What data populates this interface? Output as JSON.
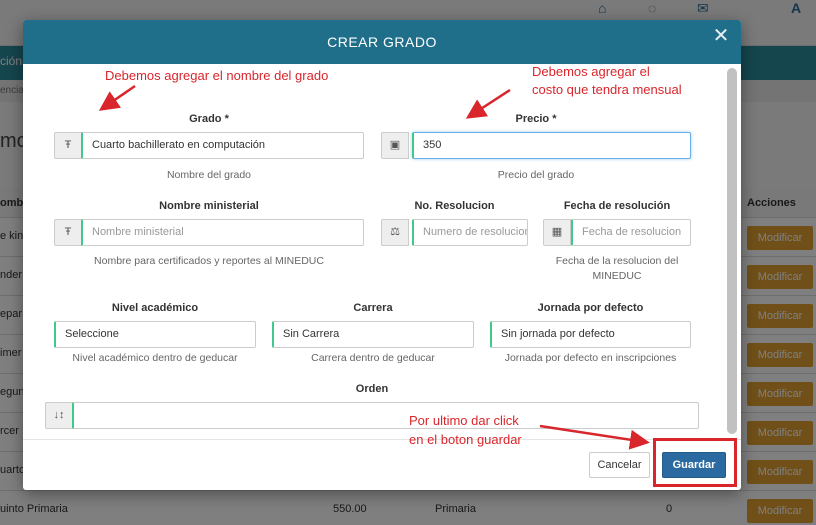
{
  "background": {
    "teal_bar_text": "ción",
    "breadcrumb_text": "encia",
    "page_title_fragment": "mo",
    "table_header_col1": "ombr",
    "table_header_actions": "Acciones",
    "row_fragments": [
      "e kin",
      "nder",
      "epar",
      "imer",
      "egun",
      "rcer",
      "uarto",
      "uinto Primaria"
    ],
    "last_row_price": "550.00",
    "last_row_level": "Primaria",
    "last_row_order": "0",
    "action_button_label": "Modificar"
  },
  "modal": {
    "title": "CREAR GRADO",
    "close_icon": "close-icon",
    "fields": {
      "grado": {
        "label": "Grado *",
        "value": "Cuarto bachillerato en computación",
        "help": "Nombre del grado",
        "icon": "text-icon"
      },
      "precio": {
        "label": "Precio *",
        "value": "350",
        "help": "Precio del grado",
        "icon": "money-icon"
      },
      "nombre_ministerial": {
        "label": "Nombre ministerial",
        "placeholder": "Nombre ministerial",
        "help": "Nombre para certificados y reportes al MINEDUC",
        "icon": "text-icon"
      },
      "no_resolucion": {
        "label": "No. Resolucion",
        "placeholder": "Numero de resolucion",
        "icon": "scale-icon"
      },
      "fecha_resolucion": {
        "label": "Fecha de resolución",
        "placeholder": "Fecha de resolucion",
        "help_line1": "Fecha de la resolucion del",
        "help_line2": "MINEDUC",
        "icon": "calendar-icon"
      },
      "nivel_academico": {
        "label": "Nivel académico",
        "value": "Seleccione",
        "help": "Nivel académico dentro de geducar"
      },
      "carrera": {
        "label": "Carrera",
        "value": "Sin Carrera",
        "help": "Carrera dentro de geducar"
      },
      "jornada": {
        "label": "Jornada por defecto",
        "value": "Sin jornada por defecto",
        "help": "Jornada por defecto en inscripciones"
      },
      "orden": {
        "label": "Orden",
        "value": "",
        "icon": "sort-icon"
      }
    },
    "footer": {
      "cancel_label": "Cancelar",
      "save_label": "Guardar"
    }
  },
  "annotations": {
    "note1": "Debemos agregar el nombre del grado",
    "note2_line1": "Debemos agregar el",
    "note2_line2": "costo que tendra mensual",
    "note3_line1": "Por ultimo dar click",
    "note3_line2": "en el boton guardar"
  },
  "colors": {
    "header": "#1f6f8b",
    "save_button": "#2a6aa0",
    "field_accent": "#3fc98b",
    "annotation": "#d9262c",
    "action_button": "#e0a030"
  }
}
